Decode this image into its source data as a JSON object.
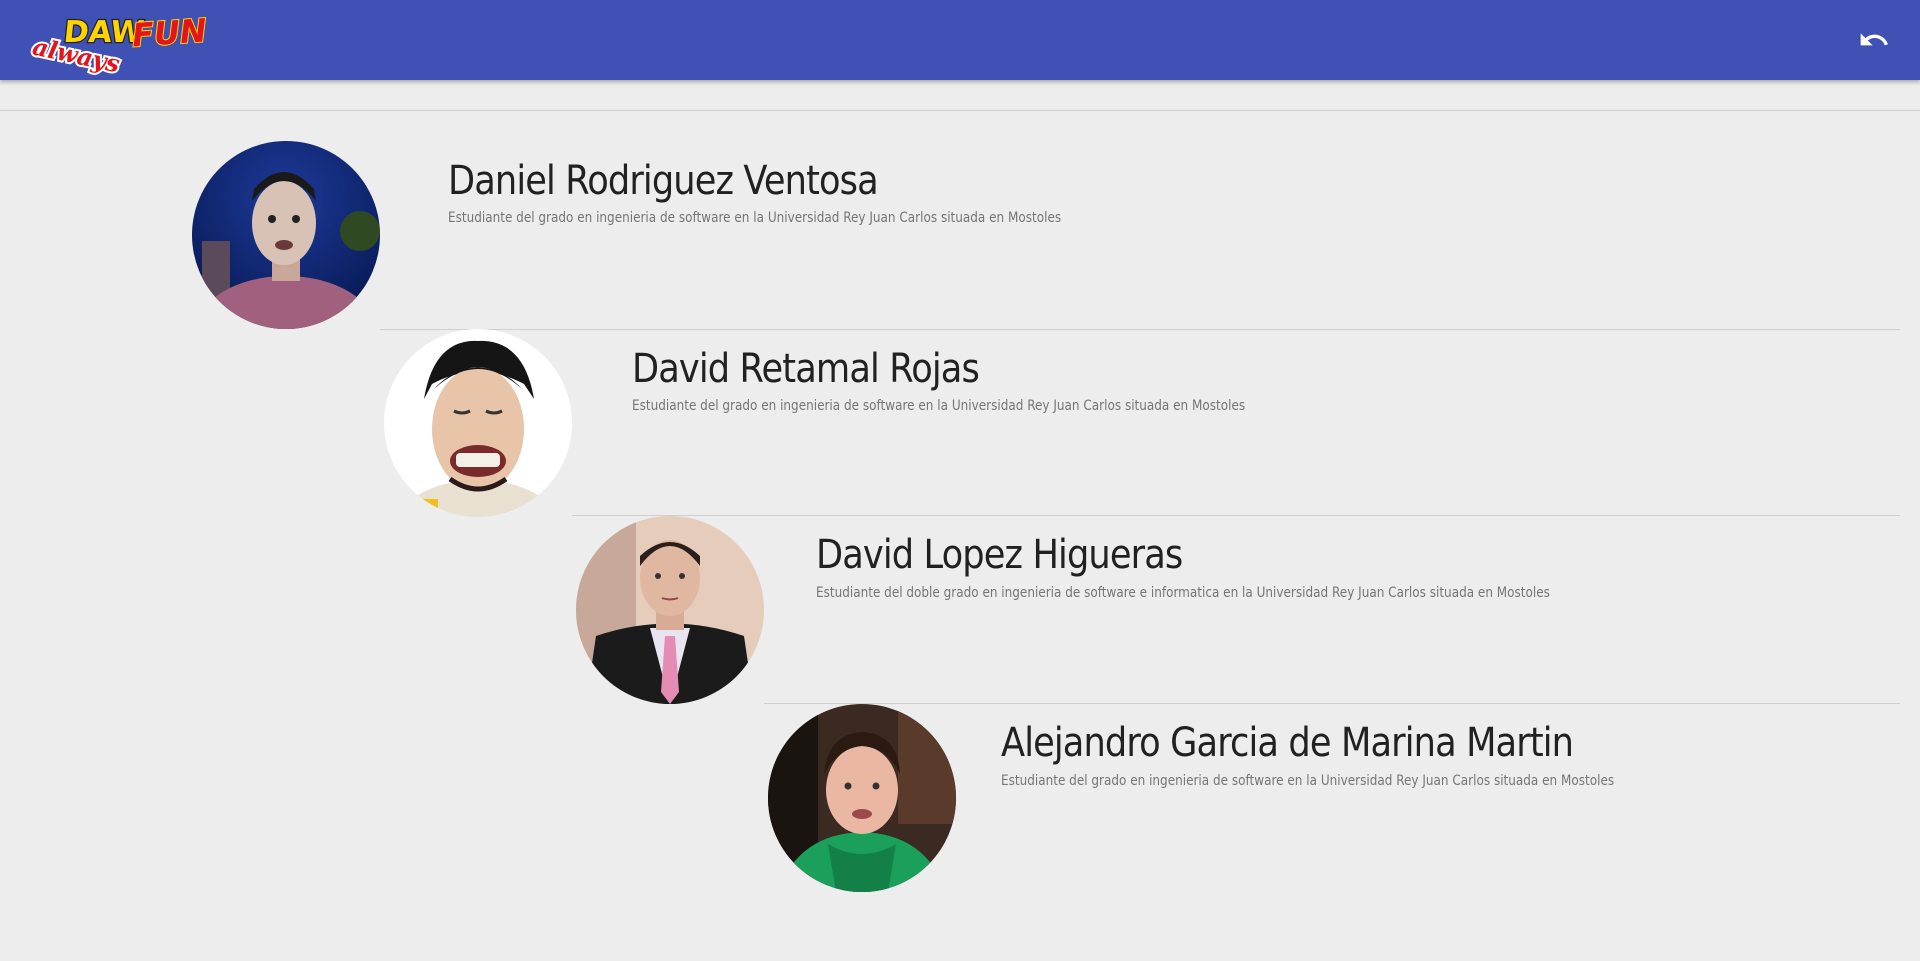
{
  "header": {
    "logo_text": "DAWFUN always",
    "back_icon": "undo-arrow-icon",
    "colors": {
      "bar": "#3f51b5",
      "logo_yellow": "#ffd400",
      "logo_red": "#e3141b"
    }
  },
  "members": [
    {
      "name": "Daniel Rodriguez Ventosa",
      "description": "Estudiante del grado en ingenieria de software en la Universidad Rey Juan Carlos situada en Mostoles",
      "avatar_icon": "person-photo-night-sky"
    },
    {
      "name": "David Retamal Rojas",
      "description": "Estudiante del grado en ingenieria de software en la Universidad Rey Juan Carlos situada en Mostoles",
      "avatar_icon": "person-photo-white-background"
    },
    {
      "name": "David Lopez Higueras",
      "description": "Estudiante del doble grado en ingenieria de software e informatica en la Universidad Rey Juan Carlos situada en Mostoles",
      "avatar_icon": "person-photo-suit-tie"
    },
    {
      "name": "Alejandro Garcia de Marina Martin",
      "description": "Estudiante del grado en ingenieria de software en la Universidad Rey Juan Carlos situada en Mostoles",
      "avatar_icon": "person-photo-green-hoodie"
    }
  ]
}
